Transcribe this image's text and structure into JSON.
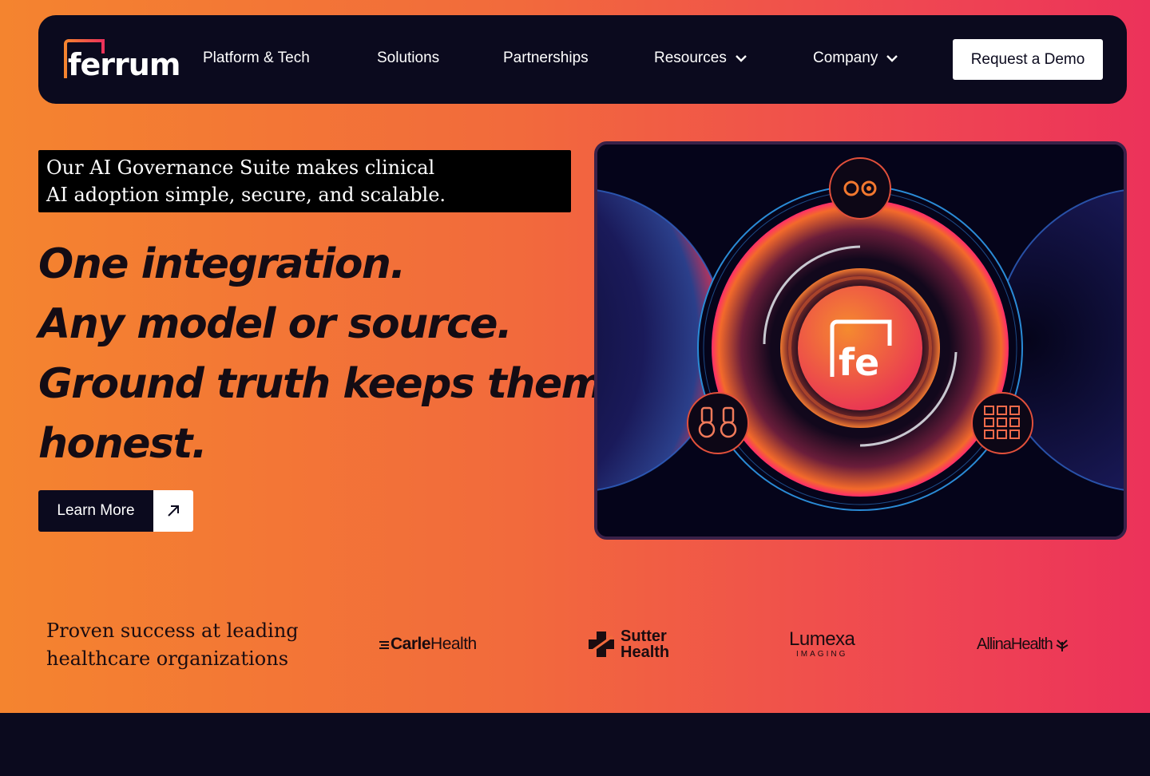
{
  "nav": {
    "logo_text": "ferrum",
    "items": [
      {
        "label": "Platform & Tech",
        "has_dropdown": false
      },
      {
        "label": "Solutions",
        "has_dropdown": false
      },
      {
        "label": "Partnerships",
        "has_dropdown": false
      },
      {
        "label": "Resources",
        "has_dropdown": true
      },
      {
        "label": "Company",
        "has_dropdown": true
      }
    ],
    "cta_label": "Request a Demo"
  },
  "hero": {
    "tagline_line1": "Our AI Governance Suite makes clinical",
    "tagline_line2": "AI adoption simple, secure, and scalable.",
    "headline_lines": [
      "One integration.",
      "Any model or source.",
      "Ground truth keeps them",
      "honest."
    ],
    "learn_more_label": "Learn More",
    "visual_core_text": "fe"
  },
  "partners": {
    "heading_line1": "Proven success at leading",
    "heading_line2": "healthcare organizations",
    "logos": [
      {
        "name": "CarleHealth",
        "part1": "Carle",
        "part2": "Health"
      },
      {
        "name": "Sutter Health",
        "part1": "Sutter",
        "part2": "Health"
      },
      {
        "name": "Lumexa Imaging",
        "part1": "Lumexa",
        "part2": "IMAGING"
      },
      {
        "name": "Allina Health",
        "part1": "Allina",
        "part2": "Health"
      }
    ]
  },
  "colors": {
    "gradient_start": "#f4842f",
    "gradient_end": "#ec325a",
    "nav_bg": "#0b0a1e"
  }
}
